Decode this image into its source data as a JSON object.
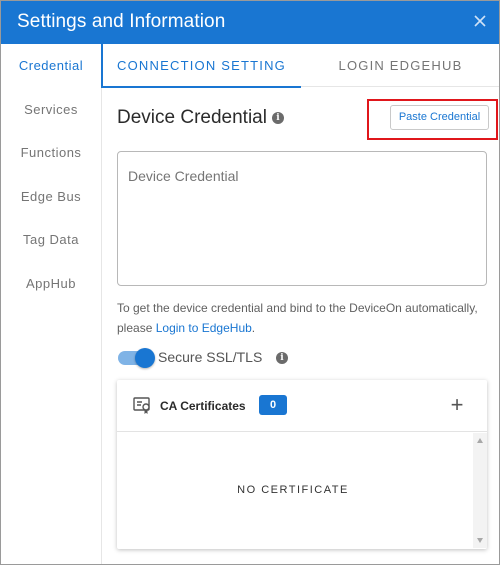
{
  "window": {
    "title": "Settings and Information",
    "close_icon": "close-icon"
  },
  "sidebar": {
    "items": [
      {
        "label": "Credential",
        "active": true
      },
      {
        "label": "Services",
        "active": false
      },
      {
        "label": "Functions",
        "active": false
      },
      {
        "label": "Edge Bus",
        "active": false
      },
      {
        "label": "Tag Data",
        "active": false
      },
      {
        "label": "AppHub",
        "active": false
      }
    ]
  },
  "tabs": [
    {
      "label": "CONNECTION SETTING",
      "active": true
    },
    {
      "label": "LOGIN EDGEHUB",
      "active": false
    }
  ],
  "credential": {
    "heading": "Device Credential",
    "info_icon": "info-icon",
    "paste_button": "Paste Credential",
    "textarea_placeholder": "Device Credential",
    "textarea_value": ""
  },
  "help": {
    "text": "To get the device credential and bind to the DeviceOn automatically, please",
    "link": "Login to EdgeHub",
    "suffix": "."
  },
  "ssl": {
    "label": "Secure SSL/TLS",
    "enabled": true
  },
  "certificates": {
    "icon": "certificate-icon",
    "title": "CA Certificates",
    "count": "0",
    "add_icon": "plus-icon",
    "empty_text": "NO CERTIFICATE"
  },
  "colors": {
    "accent": "#1976d2",
    "highlight": "#e0161b"
  }
}
